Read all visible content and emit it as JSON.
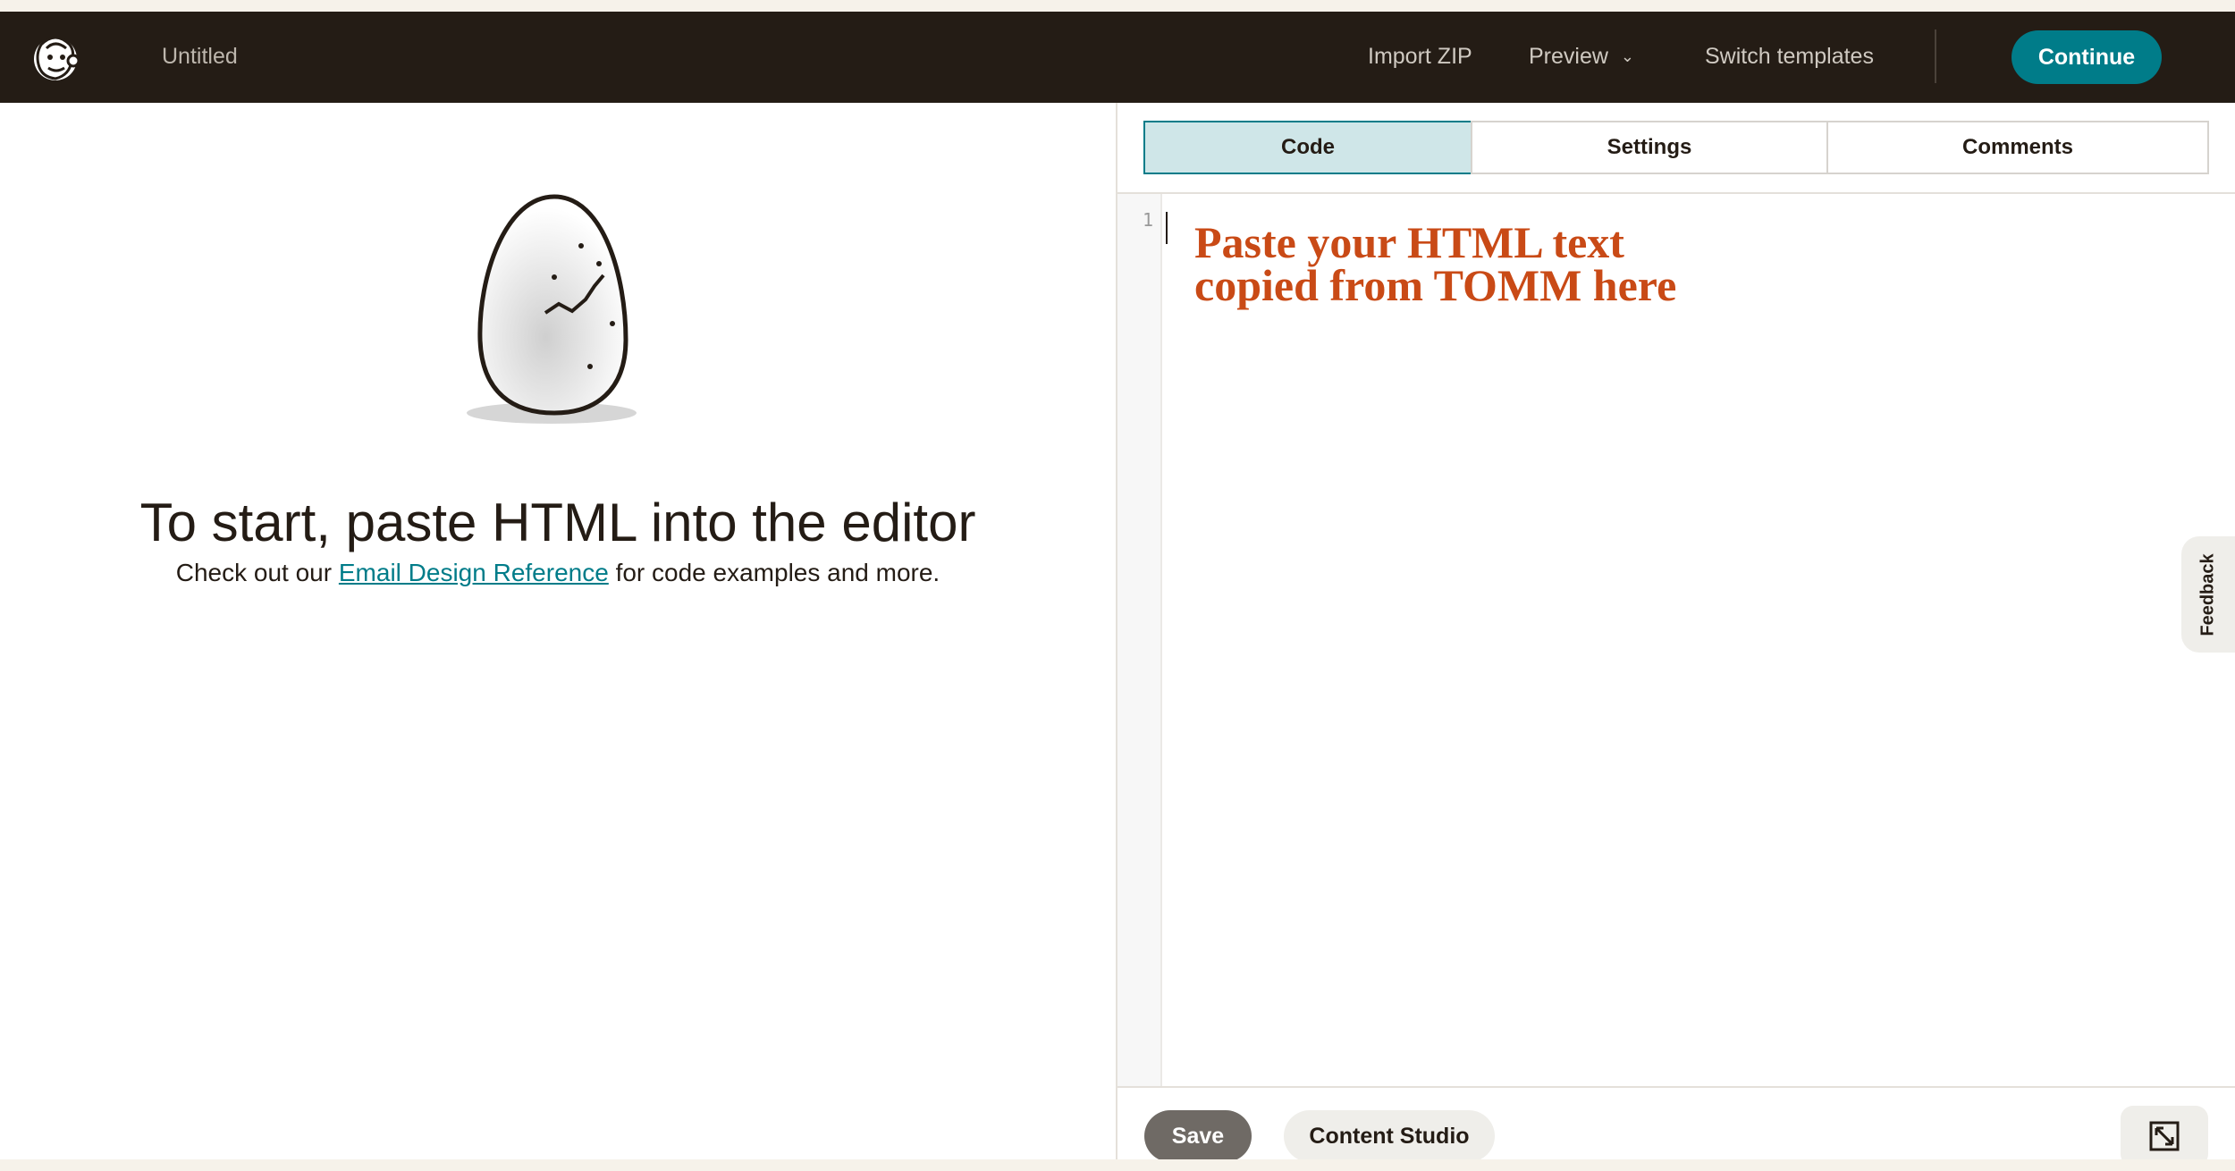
{
  "header": {
    "document_title": "Untitled",
    "import_zip": "Import ZIP",
    "preview": "Preview",
    "switch_templates": "Switch templates",
    "continue_label": "Continue"
  },
  "left": {
    "headline": "To start, paste HTML into the editor",
    "sub_prefix": "Check out our ",
    "link_text": "Email Design Reference",
    "sub_suffix": " for code examples and more."
  },
  "editor": {
    "tabs": [
      {
        "label": "Code",
        "active": true
      },
      {
        "label": "Settings",
        "active": false
      },
      {
        "label": "Comments",
        "active": false
      }
    ],
    "line_number": "1",
    "overlay_note": "Paste your HTML text copied from TOMM here"
  },
  "footer": {
    "save_label": "Save",
    "content_studio_label": "Content Studio"
  },
  "feedback_label": "Feedback",
  "colors": {
    "header_bg": "#241c15",
    "accent": "#007c89",
    "active_tab": "#cfe6e8",
    "note_text": "#c94a16"
  }
}
